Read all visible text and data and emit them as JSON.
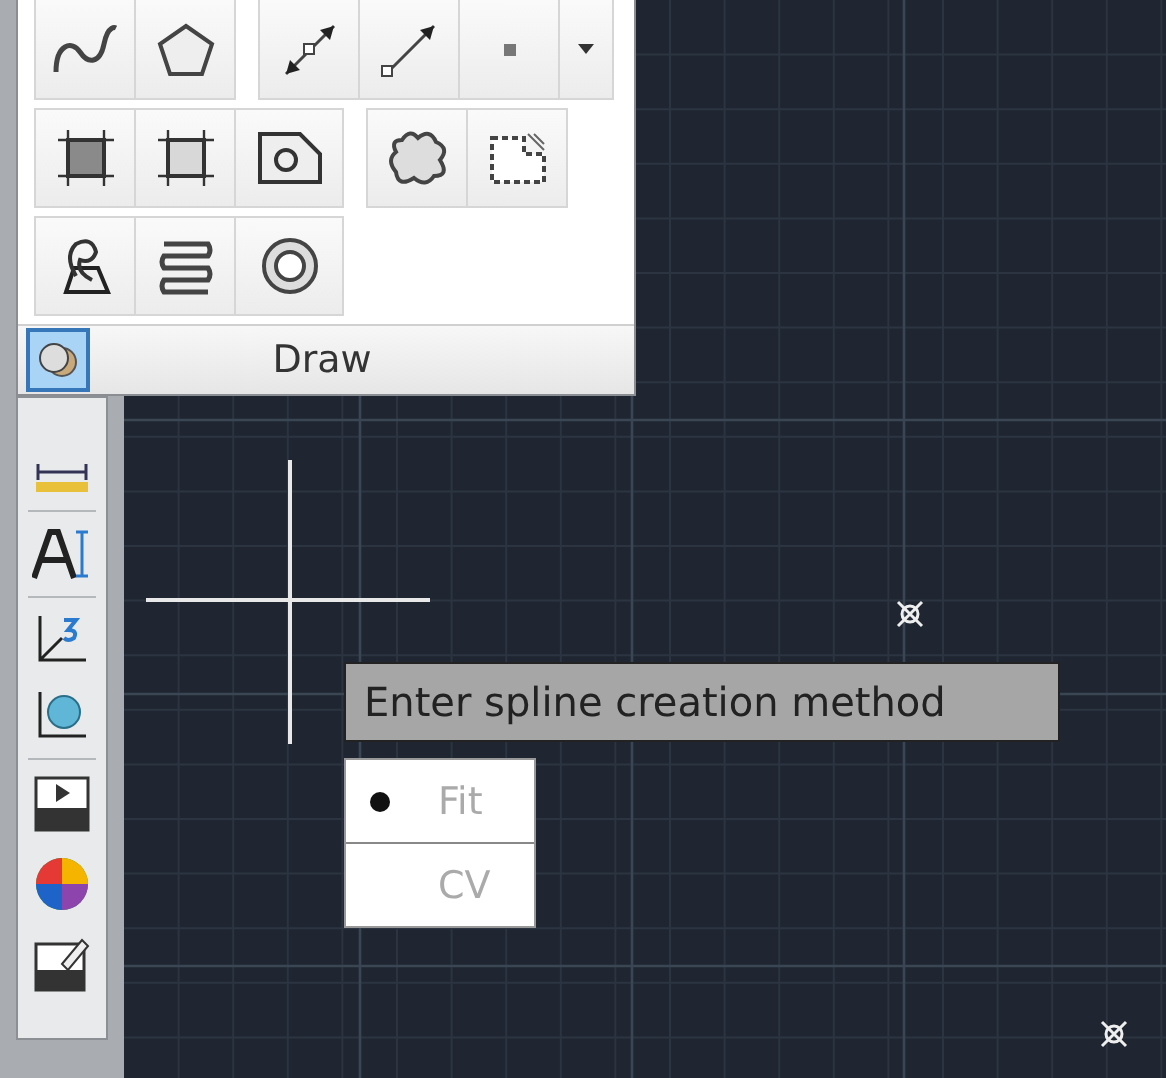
{
  "draw_panel": {
    "title": "Draw",
    "pin_button": {
      "selected": true
    }
  },
  "prompt": {
    "text": "Enter spline creation method"
  },
  "options": [
    {
      "label": "Fit",
      "selected": true
    },
    {
      "label": "CV",
      "selected": false
    }
  ]
}
